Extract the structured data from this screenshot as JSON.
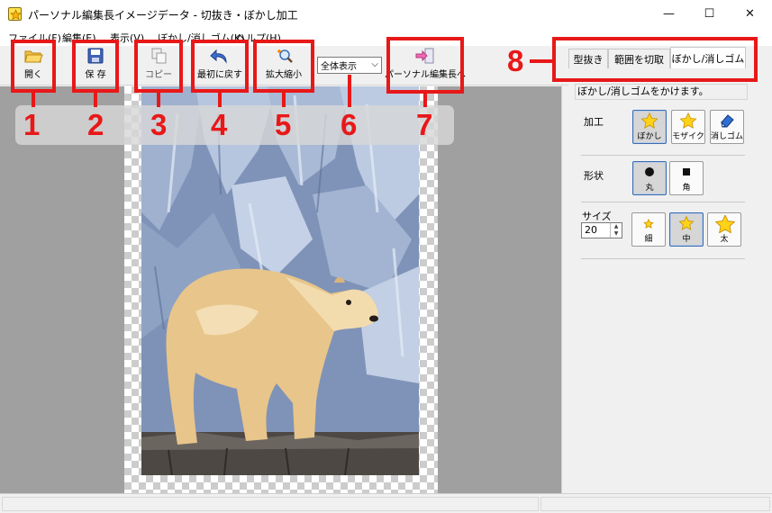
{
  "window": {
    "title": "パーソナル編集長イメージデータ - 切抜き・ぼかし加工",
    "minimize": "—",
    "maximize": "☐",
    "close": "✕"
  },
  "menu": [
    {
      "label": "ファイル(F)"
    },
    {
      "label": "編集(E)"
    },
    {
      "label": "表示(V)"
    },
    {
      "label": "ぼかし/消しゴム(K)"
    },
    {
      "label": "ヘルプ(H)"
    }
  ],
  "toolbar": {
    "open": "開く",
    "save": "保 存",
    "copy": "コピー",
    "revert": "最初に戻す",
    "zoom": "拡大縮小",
    "zoom_select": "全体表示",
    "to_editor": "パーソナル編集長へ"
  },
  "callouts": [
    "1",
    "2",
    "3",
    "4",
    "5",
    "6",
    "7",
    "8"
  ],
  "panel": {
    "tabs": [
      "型抜き",
      "範囲を切取",
      "ぼかし/消しゴム"
    ],
    "description": "ぼかし/消しゴムをかけます。",
    "process": {
      "label": "加工",
      "options": [
        {
          "label": "ぼかし",
          "selected": true
        },
        {
          "label": "モザイク",
          "selected": false
        },
        {
          "label": "消しゴム",
          "selected": false
        }
      ]
    },
    "shape": {
      "label": "形状",
      "options": [
        {
          "label": "丸",
          "selected": true
        },
        {
          "label": "角",
          "selected": false
        }
      ]
    },
    "size": {
      "label": "サイズ",
      "value": "20",
      "options": [
        {
          "label": "細",
          "selected": false
        },
        {
          "label": "中",
          "selected": true
        },
        {
          "label": "太",
          "selected": false
        }
      ]
    }
  },
  "colors": {
    "annotation_red": "#e81818",
    "canvas_gray": "#a0a0a0",
    "star_yellow": "#ffd21a"
  },
  "icons": [
    "app-icon",
    "folder-open-icon",
    "floppy-disk-icon",
    "copy-icon",
    "undo-arrow-icon",
    "magnifier-plus-icon",
    "export-arrow-icon",
    "star-icon",
    "circle-icon",
    "square-icon",
    "eraser-icon",
    "polar-bear-photo"
  ]
}
